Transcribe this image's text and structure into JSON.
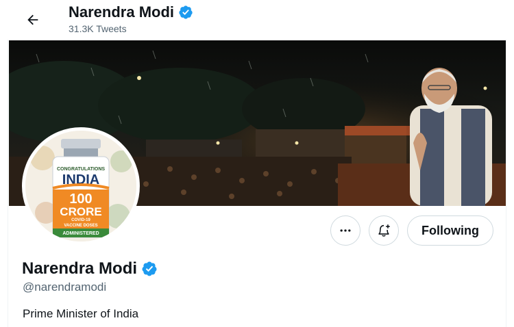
{
  "header": {
    "name": "Narendra Modi",
    "tweet_count": "31.3K Tweets"
  },
  "avatar": {
    "badge_lines": [
      "CONGRATULATIONS",
      "INDIA",
      "100",
      "CRORE",
      "COVID-19",
      "VACCINE DOSES",
      "ADMINISTERED"
    ]
  },
  "actions": {
    "more_icon": "more-horizontal-icon",
    "notify_icon": "bell-plus-icon",
    "follow_label": "Following"
  },
  "profile": {
    "name": "Narendra Modi",
    "handle": "@narendramodi",
    "bio": "Prime Minister of India"
  },
  "colors": {
    "verified": "#1d9bf0",
    "secondary_text": "#536471",
    "border": "#cfd9de"
  }
}
